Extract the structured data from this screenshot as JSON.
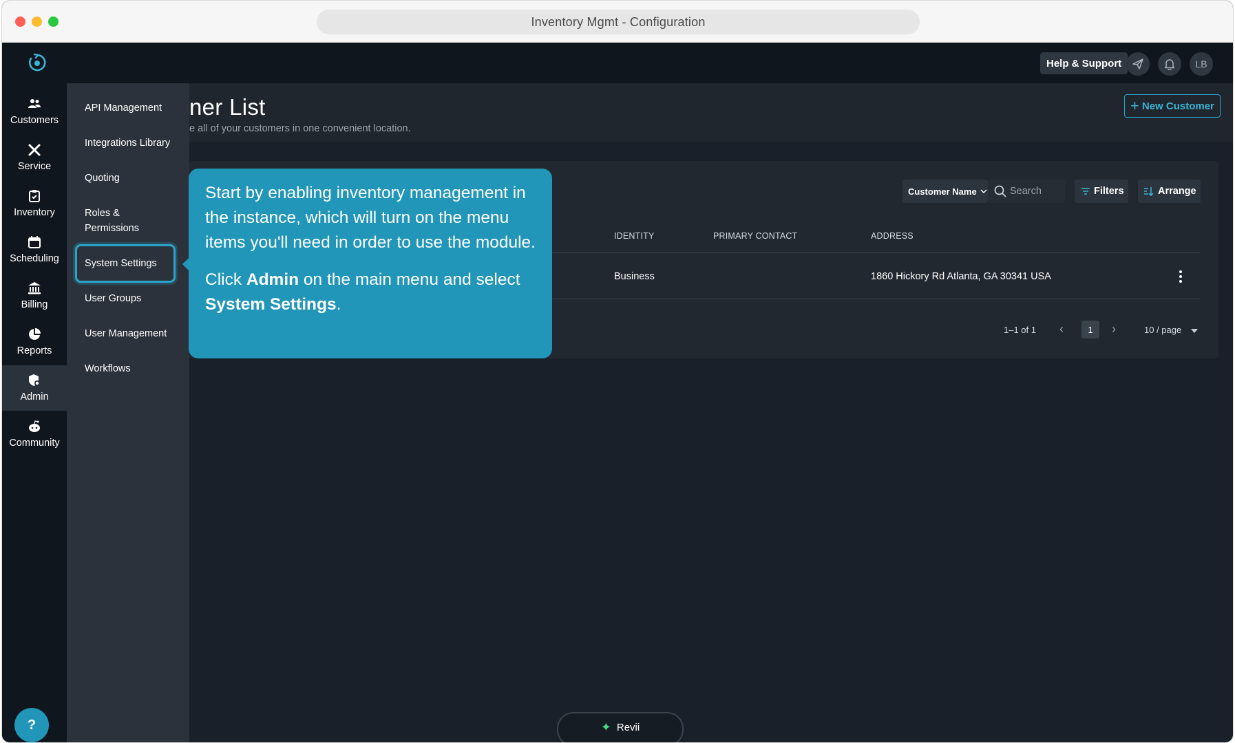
{
  "window": {
    "title": "Inventory Mgmt - Configuration"
  },
  "topbar": {
    "help_label": "Help & Support",
    "avatar_initials": "LB"
  },
  "rail": {
    "items": [
      {
        "label": "Customers"
      },
      {
        "label": "Service"
      },
      {
        "label": "Inventory"
      },
      {
        "label": "Scheduling"
      },
      {
        "label": "Billing"
      },
      {
        "label": "Reports"
      },
      {
        "label": "Admin",
        "active": true
      },
      {
        "label": "Community"
      }
    ],
    "help_label": "?"
  },
  "admin_menu": {
    "items": [
      {
        "label": "API Management"
      },
      {
        "label": "Integrations Library"
      },
      {
        "label": "Quoting"
      },
      {
        "label": "Roles &"
      },
      {
        "label": "Permissions"
      },
      {
        "label": "System Settings",
        "highlighted": true
      },
      {
        "label": "User Groups"
      },
      {
        "label": "User Management"
      },
      {
        "label": "Workflows"
      }
    ]
  },
  "page": {
    "title": "ner List",
    "subtitle": "e all of your customers in one convenient location.",
    "new_button": "New Customer"
  },
  "toolbar": {
    "field_select": "Customer Name",
    "search_placeholder": "Search",
    "filters_label": "Filters",
    "arrange_label": "Arrange"
  },
  "table": {
    "columns": [
      "IDENTITY",
      "PRIMARY CONTACT",
      "ADDRESS"
    ],
    "rows": [
      {
        "identity": "Business",
        "primary_contact": "",
        "address": "1860 Hickory Rd Atlanta, GA 30341 USA"
      }
    ]
  },
  "pagination": {
    "range": "1–1 of 1",
    "current_page": "1",
    "page_size": "10 / page"
  },
  "callout": {
    "line1": "Start by enabling inventory management in the instance, which will turn on the menu items you'll need in order to use the module.",
    "p2_pre": "Click ",
    "p2_bold1": "Admin",
    "p2_mid": " on the main menu and select ",
    "p2_bold2": "System Settings",
    "p2_end": "."
  },
  "assistant": {
    "label": "Revii"
  },
  "colors": {
    "accent": "#2196b8",
    "background": "#192029",
    "rail": "#10161d",
    "flyout": "#2b323b"
  }
}
